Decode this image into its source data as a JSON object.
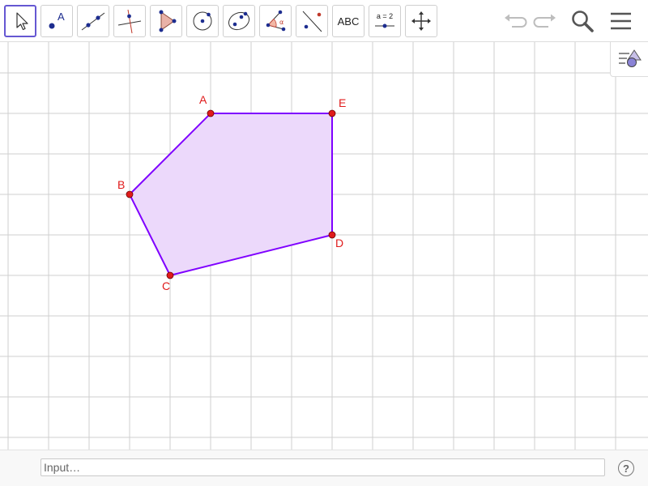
{
  "toolbar": {
    "tools": [
      {
        "name": "Move",
        "icon": "move-arrow-icon",
        "active": true
      },
      {
        "name": "Point",
        "icon": "point-icon",
        "label": "A"
      },
      {
        "name": "Line",
        "icon": "line-icon"
      },
      {
        "name": "Perpendicular Line",
        "icon": "perpendicular-line-icon"
      },
      {
        "name": "Polygon",
        "icon": "polygon-icon"
      },
      {
        "name": "Circle with Center through Point",
        "icon": "circle-center-point-icon"
      },
      {
        "name": "Ellipse",
        "icon": "ellipse-icon"
      },
      {
        "name": "Angle",
        "icon": "angle-icon",
        "label": "α"
      },
      {
        "name": "Reflect about Line",
        "icon": "reflect-line-icon"
      },
      {
        "name": "Text",
        "icon": "text-icon",
        "label": "ABC"
      },
      {
        "name": "Slider",
        "icon": "slider-icon",
        "label": "a = 2"
      },
      {
        "name": "Move Graphics View",
        "icon": "move-graphics-view-icon"
      }
    ],
    "undo_icon": "undo-icon",
    "redo_icon": "redo-icon",
    "search_icon": "search-icon",
    "menu_icon": "hamburger-menu-icon"
  },
  "graphics": {
    "grid": true,
    "polygon_color": "#7f00ff",
    "polygon_fill": "#ecd9fb",
    "point_color": "#e01b1b",
    "points": [
      {
        "label": "A",
        "x": 4,
        "y": 8
      },
      {
        "label": "B",
        "x": 2,
        "y": 6
      },
      {
        "label": "C",
        "x": 3,
        "y": 4
      },
      {
        "label": "D",
        "x": 7,
        "y": 5
      },
      {
        "label": "E",
        "x": 7,
        "y": 8
      }
    ],
    "polygon_order": [
      "A",
      "B",
      "C",
      "D",
      "E"
    ]
  },
  "style_bar_icon": "style-bar-icon",
  "input_bar": {
    "placeholder": "Input…",
    "help_label": "?"
  }
}
